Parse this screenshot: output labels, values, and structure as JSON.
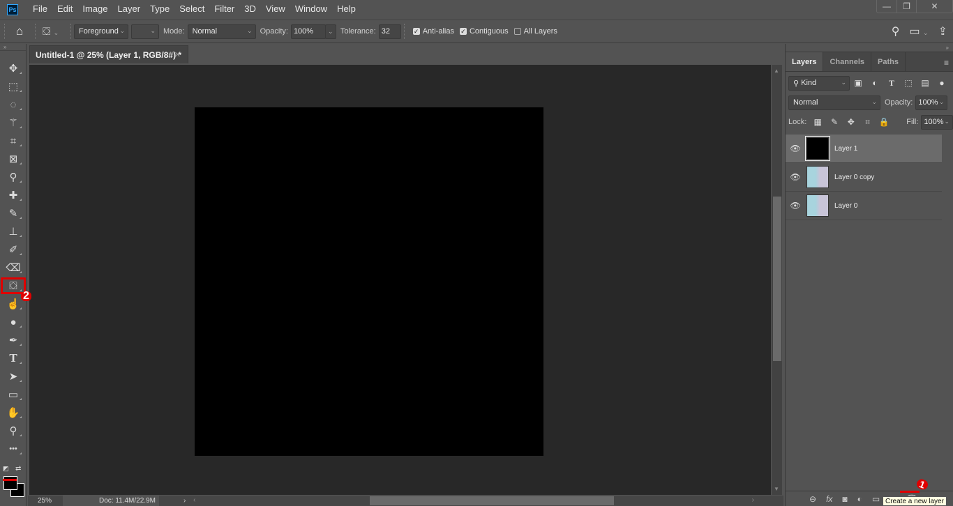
{
  "app": {
    "logo": "Ps"
  },
  "menu": [
    "File",
    "Edit",
    "Image",
    "Layer",
    "Type",
    "Select",
    "Filter",
    "3D",
    "View",
    "Window",
    "Help"
  ],
  "window_controls": {
    "minimize": "—",
    "restore": "❐",
    "close": "✕"
  },
  "options": {
    "fill_source": "Foreground",
    "mode_label": "Mode:",
    "mode_value": "Normal",
    "opacity_label": "Opacity:",
    "opacity_value": "100%",
    "tolerance_label": "Tolerance:",
    "tolerance_value": "32",
    "anti_alias": {
      "label": "Anti-alias",
      "checked": true
    },
    "contiguous": {
      "label": "Contiguous",
      "checked": true
    },
    "all_layers": {
      "label": "All Layers",
      "checked": false
    }
  },
  "document": {
    "tab_title": "Untitled-1 @ 25% (Layer 1, RGB/8#) *",
    "close": "✕",
    "canvas_color": "#000000"
  },
  "tools": [
    {
      "name": "move",
      "glyph": "✥"
    },
    {
      "name": "marquee",
      "glyph": "⬚"
    },
    {
      "name": "lasso",
      "glyph": "◌"
    },
    {
      "name": "magic-wand",
      "glyph": "⚚"
    },
    {
      "name": "crop",
      "glyph": "⌗"
    },
    {
      "name": "frame",
      "glyph": "⊠"
    },
    {
      "name": "eyedropper",
      "glyph": "⚲"
    },
    {
      "name": "healing",
      "glyph": "✚"
    },
    {
      "name": "brush",
      "glyph": "✎"
    },
    {
      "name": "stamp",
      "glyph": "⊥"
    },
    {
      "name": "history-brush",
      "glyph": "✐"
    },
    {
      "name": "eraser",
      "glyph": "⌫"
    },
    {
      "name": "paint-bucket",
      "glyph": "⛋"
    },
    {
      "name": "smudge",
      "glyph": "☝"
    },
    {
      "name": "dodge",
      "glyph": "●"
    },
    {
      "name": "pen",
      "glyph": "✒"
    },
    {
      "name": "type",
      "glyph": "T"
    },
    {
      "name": "path-select",
      "glyph": "➤"
    },
    {
      "name": "rectangle",
      "glyph": "▭"
    },
    {
      "name": "hand",
      "glyph": "✋"
    },
    {
      "name": "zoom",
      "glyph": "⚲"
    },
    {
      "name": "more",
      "glyph": "•••"
    }
  ],
  "colors": {
    "foreground": "#000000",
    "background": "#000000"
  },
  "status": {
    "zoom": "25%",
    "doc": "Doc: 11.4M/22.9M"
  },
  "panel": {
    "tabs": [
      "Layers",
      "Channels",
      "Paths"
    ],
    "filter": "Kind",
    "blend": "Normal",
    "opacity_label": "Opacity:",
    "opacity_value": "100%",
    "lock_label": "Lock:",
    "fill_label": "Fill:",
    "fill_value": "100%",
    "layers": [
      {
        "name": "Layer 1",
        "selected": true
      },
      {
        "name": "Layer 0 copy",
        "selected": false
      },
      {
        "name": "Layer 0",
        "selected": false
      }
    ],
    "tooltip": "Create a new layer"
  },
  "annotations": {
    "step1": "1",
    "step2": "2"
  }
}
